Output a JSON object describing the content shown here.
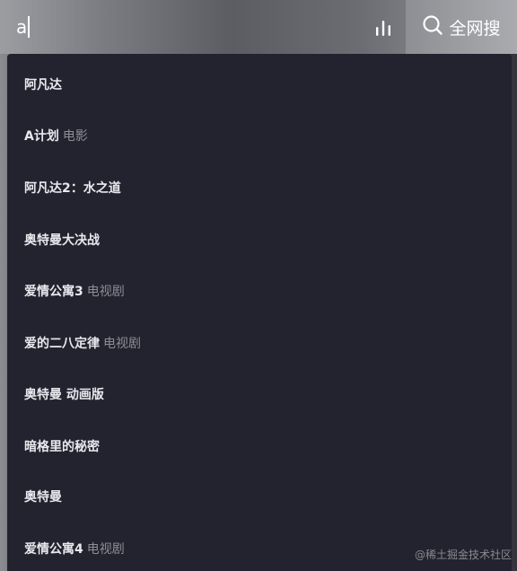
{
  "search": {
    "query": "a",
    "search_button_label": "全网搜"
  },
  "suggestions": [
    {
      "text": "阿凡达",
      "tag": ""
    },
    {
      "text": "A计划",
      "tag": "电影"
    },
    {
      "text": "阿凡达2：水之道",
      "tag": ""
    },
    {
      "text": "奥特曼大决战",
      "tag": ""
    },
    {
      "text": "爱情公寓3",
      "tag": "电视剧"
    },
    {
      "text": "爱的二八定律",
      "tag": "电视剧"
    },
    {
      "text": "奥特曼 动画版",
      "tag": ""
    },
    {
      "text": "暗格里的秘密",
      "tag": ""
    },
    {
      "text": "奥特曼",
      "tag": ""
    },
    {
      "text": "爱情公寓4",
      "tag": "电视剧"
    }
  ],
  "watermark": "@稀土掘金技术社区",
  "icons": {
    "voice": "sound-bars-icon",
    "search": "search-icon"
  }
}
